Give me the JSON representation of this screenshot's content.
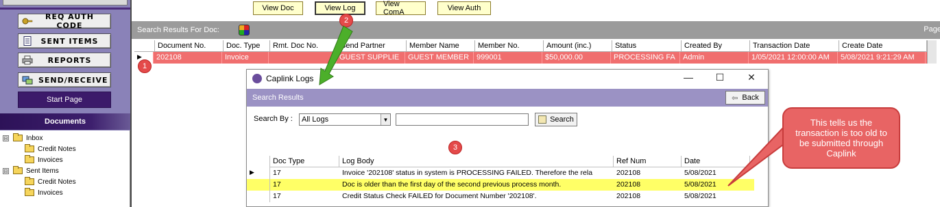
{
  "sidebar": {
    "buttons": [
      {
        "label": "REQ AUTH CODE",
        "icon": "key-icon"
      },
      {
        "label": "SENT ITEMS",
        "icon": "document-icon"
      },
      {
        "label": "REPORTS",
        "icon": "printer-icon"
      },
      {
        "label": "SEND/RECEIVE",
        "icon": "send-receive-icon"
      }
    ],
    "start_page": "Start Page",
    "documents": "Documents",
    "tree": [
      {
        "label": "Inbox",
        "toggle": "⊟"
      },
      {
        "label": "Credit Notes"
      },
      {
        "label": "Invoices"
      },
      {
        "label": "Sent Items",
        "toggle": "⊟"
      },
      {
        "label": "Credit Notes"
      },
      {
        "label": "Invoices"
      }
    ]
  },
  "toolbar": {
    "view_doc": "View Doc",
    "view_log": "View Log",
    "view_coma": "View ComA",
    "view_auth": "View Auth"
  },
  "results": {
    "title": "Search Results For Doc:",
    "page": "Page"
  },
  "grid": {
    "columns": [
      "Document No.",
      "Doc. Type",
      "Rmt. Doc No.",
      "Send Partner",
      "Member Name",
      "Member No.",
      "Amount (inc.)",
      "Status",
      "Created By",
      "Transaction Date",
      "Create Date"
    ],
    "row": [
      "202108",
      "Invoice",
      "",
      "GUEST SUPPLIE",
      "GUEST MEMBER",
      "999001",
      "$50,000.00",
      "PROCESSING FA",
      "Admin",
      "1/05/2021 12:00:00 AM",
      "5/08/2021 9:21:29 AM"
    ],
    "row_indicator": "▶"
  },
  "badges": {
    "one": "1",
    "two": "2",
    "three": "3"
  },
  "dialog": {
    "title": "Caplink Logs",
    "minimize": "—",
    "maximize": "☐",
    "close": "✕",
    "search_results": "Search Results",
    "back": "Back",
    "back_arrow": "⇦",
    "search_by_label": "Search By :",
    "search_by_value": "All Logs",
    "search_input_value": "",
    "search_button": "Search",
    "columns": [
      "Doc Type",
      "Log Body",
      "Ref Num",
      "Date"
    ],
    "rows": [
      {
        "indicator": "▶",
        "doc_type": "17",
        "log_body": "Invoice '202108' status in system is PROCESSING FAILED. Therefore the rela",
        "ref_num": "202108",
        "date": "5/08/2021"
      },
      {
        "indicator": "",
        "doc_type": "17",
        "log_body": "Doc is older than the first day of the second previous process month.",
        "ref_num": "202108",
        "date": "5/08/2021"
      },
      {
        "indicator": "",
        "doc_type": "17",
        "log_body": "Credit Status Check FAILED for Document Number '202108'.",
        "ref_num": "202108",
        "date": "5/08/2021"
      }
    ]
  },
  "callout": {
    "text": "This tells us the transaction is too old to be submitted through Caplink"
  },
  "colors": {
    "sidebar": "#8a82b8",
    "highlight_row": "#f06e6e",
    "log_highlight": "#ffff66",
    "callout": "#e86464",
    "arrow": "#4caf2a"
  }
}
